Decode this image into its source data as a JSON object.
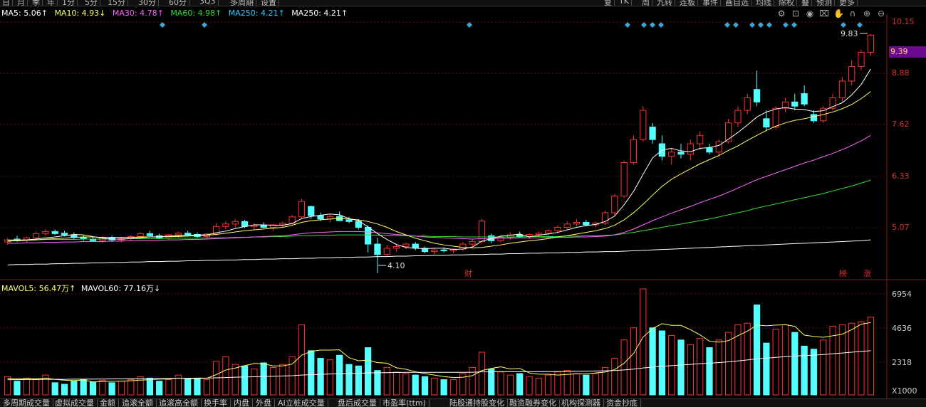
{
  "topbar": {
    "items": [
      "日",
      "月",
      "季",
      "年",
      "1分",
      "5分",
      "15分",
      "30分",
      "60分",
      "3Q3",
      "多周期",
      "设置"
    ],
    "right_items": [
      "复",
      "TK",
      "周",
      "九转",
      "连板",
      "事件",
      "画自选",
      "均线",
      "除权",
      "叠",
      "预测",
      "更多"
    ]
  },
  "ma_legend": {
    "ma5": "MA5: 5.06↑",
    "ma10": "MA10: 4.93↓",
    "ma30": "MA30: 4.78↑",
    "ma60": "MA60: 4.98↑",
    "ma250a": "MA250: 4.21↑",
    "ma250b": "MA250: 4.21↑"
  },
  "price_axis": [
    "10.15",
    "8.88",
    "7.62",
    "6.33",
    "5.07"
  ],
  "current_price": "9.39",
  "high_label": "9.83",
  "low_label": "4.10",
  "markers": {
    "cai": "财",
    "bang": "榜",
    "zhang": "涨"
  },
  "vol_legend": {
    "mavol5": "MAVOL5: 56.47万↑",
    "mavol60": "MAVOL60: 77.16万↓"
  },
  "vol_axis": [
    "6954",
    "4636",
    "2318"
  ],
  "vol_unit": "X1000",
  "bottom_tabs": [
    "多周期成交量",
    "虚拟成交量",
    "金额",
    "追滚全额",
    "追滚高全额",
    "换手率",
    "内盘",
    "外盘",
    "AI立桩成交量",
    "盘后成交量",
    "市盈率(ttm)",
    "陆股通持股变化",
    "融资融券变化",
    "机构探测器",
    "资金抄底"
  ],
  "colors": {
    "up": "#ff3232",
    "down": "#54ffff",
    "ma5": "#ffffff",
    "ma10": "#ffff66",
    "ma30": "#ff66ff",
    "ma60": "#33dd33",
    "ma250": "#ffffff"
  },
  "chart_data": {
    "type": "candlestick",
    "price_ylim": [
      4.0,
      10.3
    ],
    "vol_ylim": [
      0,
      7000
    ],
    "candles": [
      [
        4.85,
        4.95,
        4.78,
        4.9
      ],
      [
        4.92,
        5.0,
        4.85,
        4.88
      ],
      [
        4.9,
        4.98,
        4.82,
        4.95
      ],
      [
        4.95,
        5.1,
        4.9,
        5.05
      ],
      [
        5.05,
        5.15,
        5.0,
        5.1
      ],
      [
        5.1,
        5.15,
        5.02,
        5.05
      ],
      [
        5.06,
        5.12,
        4.98,
        5.02
      ],
      [
        5.02,
        5.08,
        4.92,
        4.96
      ],
      [
        4.96,
        5.02,
        4.88,
        4.92
      ],
      [
        4.92,
        4.98,
        4.85,
        4.88
      ],
      [
        4.88,
        4.98,
        4.82,
        4.95
      ],
      [
        4.95,
        5.0,
        4.85,
        4.9
      ],
      [
        4.9,
        4.98,
        4.84,
        4.93
      ],
      [
        4.93,
        5.02,
        4.88,
        4.98
      ],
      [
        4.98,
        5.08,
        4.92,
        5.05
      ],
      [
        5.05,
        5.12,
        4.98,
        5.0
      ],
      [
        5.0,
        5.05,
        4.92,
        4.95
      ],
      [
        4.95,
        5.04,
        4.9,
        5.02
      ],
      [
        5.02,
        5.1,
        4.96,
        5.06
      ],
      [
        5.06,
        5.12,
        5.0,
        5.03
      ],
      [
        5.03,
        5.08,
        4.95,
        4.98
      ],
      [
        4.98,
        5.06,
        4.92,
        5.04
      ],
      [
        5.04,
        5.3,
        5.0,
        5.22
      ],
      [
        5.22,
        5.35,
        5.15,
        5.28
      ],
      [
        5.28,
        5.4,
        5.2,
        5.34
      ],
      [
        5.34,
        5.38,
        5.18,
        5.22
      ],
      [
        5.22,
        5.3,
        5.15,
        5.25
      ],
      [
        5.25,
        5.32,
        5.18,
        5.2
      ],
      [
        5.2,
        5.28,
        5.12,
        5.26
      ],
      [
        5.26,
        5.34,
        5.2,
        5.3
      ],
      [
        5.3,
        5.5,
        5.25,
        5.45
      ],
      [
        5.45,
        5.88,
        5.4,
        5.82
      ],
      [
        5.7,
        5.72,
        5.4,
        5.48
      ],
      [
        5.48,
        5.55,
        5.35,
        5.4
      ],
      [
        5.4,
        5.52,
        5.32,
        5.46
      ],
      [
        5.46,
        5.58,
        5.4,
        5.36
      ],
      [
        5.38,
        5.45,
        5.3,
        5.34
      ],
      [
        5.34,
        5.4,
        5.15,
        5.2
      ],
      [
        5.2,
        5.25,
        4.6,
        4.8
      ],
      [
        4.8,
        4.95,
        4.1,
        4.55
      ],
      [
        4.55,
        4.78,
        4.5,
        4.7
      ],
      [
        4.7,
        4.8,
        4.62,
        4.74
      ],
      [
        4.74,
        4.84,
        4.68,
        4.8
      ],
      [
        4.8,
        4.85,
        4.65,
        4.7
      ],
      [
        4.7,
        4.74,
        4.58,
        4.62
      ],
      [
        4.62,
        4.7,
        4.55,
        4.66
      ],
      [
        4.66,
        4.72,
        4.6,
        4.64
      ],
      [
        4.64,
        4.7,
        4.58,
        4.68
      ],
      [
        4.68,
        4.85,
        4.64,
        4.8
      ],
      [
        4.8,
        4.92,
        4.75,
        4.86
      ],
      [
        4.86,
        5.4,
        4.82,
        5.35
      ],
      [
        5.0,
        5.05,
        4.82,
        4.88
      ],
      [
        4.88,
        5.0,
        4.84,
        4.96
      ],
      [
        4.96,
        5.08,
        4.9,
        5.02
      ],
      [
        5.02,
        5.1,
        4.95,
        4.98
      ],
      [
        4.98,
        5.05,
        4.92,
        5.03
      ],
      [
        5.03,
        5.1,
        4.98,
        5.06
      ],
      [
        5.06,
        5.15,
        5.0,
        5.12
      ],
      [
        5.12,
        5.25,
        5.06,
        5.2
      ],
      [
        5.2,
        5.35,
        5.14,
        5.28
      ],
      [
        5.28,
        5.4,
        5.22,
        5.32
      ],
      [
        5.32,
        5.38,
        5.24,
        5.26
      ],
      [
        5.26,
        5.34,
        5.2,
        5.3
      ],
      [
        5.3,
        5.6,
        5.26,
        5.55
      ],
      [
        5.55,
        6.0,
        5.5,
        5.95
      ],
      [
        5.95,
        6.8,
        5.9,
        6.75
      ],
      [
        6.75,
        7.4,
        6.7,
        7.3
      ],
      [
        7.3,
        8.1,
        7.25,
        8.0
      ],
      [
        7.6,
        7.7,
        7.2,
        7.3
      ],
      [
        7.2,
        7.4,
        6.8,
        6.9
      ],
      [
        6.9,
        7.1,
        6.7,
        7.0
      ],
      [
        7.0,
        7.2,
        6.85,
        6.95
      ],
      [
        6.95,
        7.3,
        6.8,
        7.2
      ],
      [
        7.2,
        7.5,
        7.05,
        7.4
      ],
      [
        7.1,
        7.2,
        6.95,
        7.0
      ],
      [
        7.0,
        7.3,
        6.9,
        7.25
      ],
      [
        7.25,
        7.8,
        7.2,
        7.7
      ],
      [
        7.7,
        8.1,
        7.6,
        8.0
      ],
      [
        8.0,
        8.4,
        7.9,
        8.3
      ],
      [
        8.5,
        8.95,
        8.1,
        8.2
      ],
      [
        7.8,
        8.0,
        7.5,
        7.6
      ],
      [
        7.6,
        8.1,
        7.55,
        8.05
      ],
      [
        8.05,
        8.3,
        7.95,
        8.2
      ],
      [
        8.2,
        8.4,
        8.0,
        8.1
      ],
      [
        8.4,
        8.6,
        8.1,
        8.15
      ],
      [
        7.9,
        8.0,
        7.7,
        7.75
      ],
      [
        7.75,
        8.1,
        7.7,
        8.05
      ],
      [
        8.05,
        8.4,
        8.0,
        8.3
      ],
      [
        8.3,
        8.8,
        8.2,
        8.7
      ],
      [
        8.7,
        9.2,
        8.6,
        9.05
      ],
      [
        9.05,
        9.45,
        8.95,
        9.39
      ],
      [
        9.39,
        9.83,
        9.3,
        9.8
      ]
    ],
    "volumes": [
      1200,
      900,
      1100,
      1000,
      1300,
      800,
      700,
      900,
      1000,
      850,
      950,
      800,
      900,
      1000,
      1200,
      1100,
      900,
      1000,
      1300,
      1050,
      1100,
      1000,
      2200,
      2500,
      2000,
      1900,
      1700,
      2100,
      1800,
      2000,
      2500,
      4600,
      2900,
      2400,
      2300,
      2600,
      2000,
      1900,
      3100,
      1600,
      1800,
      1500,
      1400,
      1300,
      1200,
      1100,
      1000,
      1000,
      1400,
      1800,
      2800,
      1700,
      1500,
      1300,
      1400,
      1200,
      1100,
      1300,
      1500,
      1600,
      1400,
      1300,
      1400,
      1800,
      2400,
      3600,
      4400,
      6954,
      4400,
      4200,
      3900,
      3600,
      3300,
      3700,
      3100,
      3600,
      4100,
      4600,
      4700,
      5900,
      3400,
      4300,
      4600,
      4100,
      3200,
      3000,
      3600,
      4500,
      4600,
      4700,
      4800,
      5100
    ],
    "ma5": [
      4.88,
      4.89,
      4.9,
      4.92,
      4.95,
      4.97,
      5.0,
      5.03,
      5.02,
      4.98,
      4.94,
      4.92,
      4.92,
      4.93,
      4.95,
      4.97,
      4.98,
      4.99,
      5.0,
      5.01,
      5.02,
      5.02,
      5.07,
      5.11,
      5.17,
      5.22,
      5.26,
      5.26,
      5.25,
      5.25,
      5.29,
      5.41,
      5.46,
      5.49,
      5.52,
      5.5,
      5.41,
      5.36,
      5.21,
      5.05,
      4.91,
      4.79,
      4.72,
      4.7,
      4.69,
      4.7,
      4.7,
      4.67,
      4.68,
      4.73,
      4.87,
      4.93,
      4.99,
      5.01,
      5.04,
      4.97,
      5.01,
      5.04,
      5.08,
      5.14,
      5.2,
      5.24,
      5.27,
      5.34,
      5.47,
      5.74,
      6.06,
      6.47,
      6.86,
      7.05,
      7.09,
      7.03,
      7.01,
      7.09,
      7.11,
      7.16,
      7.31,
      7.47,
      7.65,
      7.84,
      7.96,
      8.03,
      8.07,
      8.03,
      8.02,
      7.97,
      7.99,
      8.09,
      8.18,
      8.37,
      8.62,
      8.99
    ],
    "ma10": [
      4.87,
      4.88,
      4.89,
      4.9,
      4.92,
      4.93,
      4.94,
      4.96,
      4.97,
      4.97,
      4.96,
      4.96,
      4.96,
      4.96,
      4.97,
      4.97,
      4.97,
      4.98,
      4.98,
      4.99,
      5.0,
      5.01,
      5.03,
      5.06,
      5.09,
      5.12,
      5.14,
      5.16,
      5.18,
      5.2,
      5.25,
      5.32,
      5.36,
      5.38,
      5.4,
      5.41,
      5.4,
      5.38,
      5.34,
      5.28,
      5.2,
      5.1,
      5.02,
      4.94,
      4.88,
      4.82,
      4.78,
      4.75,
      4.72,
      4.71,
      4.72,
      4.75,
      4.78,
      4.82,
      4.85,
      4.88,
      4.9,
      4.93,
      4.97,
      5.0,
      5.04,
      5.08,
      5.12,
      5.17,
      5.25,
      5.38,
      5.55,
      5.75,
      5.97,
      6.18,
      6.35,
      6.48,
      6.6,
      6.72,
      6.82,
      6.92,
      7.04,
      7.15,
      7.28,
      7.4,
      7.52,
      7.62,
      7.7,
      7.76,
      7.8,
      7.85,
      7.9,
      7.96,
      8.04,
      8.14,
      8.28,
      8.45
    ],
    "ma30": [
      4.82,
      4.82,
      4.83,
      4.83,
      4.84,
      4.84,
      4.85,
      4.85,
      4.86,
      4.86,
      4.86,
      4.87,
      4.87,
      4.88,
      4.88,
      4.89,
      4.89,
      4.9,
      4.9,
      4.91,
      4.91,
      4.92,
      4.93,
      4.94,
      4.95,
      4.96,
      4.97,
      4.98,
      4.99,
      5.0,
      5.02,
      5.05,
      5.07,
      5.08,
      5.09,
      5.1,
      5.1,
      5.1,
      5.09,
      5.07,
      5.05,
      5.03,
      5.01,
      4.99,
      4.97,
      4.96,
      4.95,
      4.94,
      4.93,
      4.92,
      4.93,
      4.93,
      4.94,
      4.94,
      4.95,
      4.95,
      4.95,
      4.96,
      4.96,
      4.96,
      4.97,
      4.97,
      4.98,
      4.99,
      5.02,
      5.08,
      5.16,
      5.26,
      5.36,
      5.45,
      5.54,
      5.62,
      5.7,
      5.79,
      5.87,
      5.95,
      6.04,
      6.14,
      6.24,
      6.34,
      6.42,
      6.5,
      6.58,
      6.66,
      6.74,
      6.81,
      6.89,
      6.97,
      7.06,
      7.16,
      7.27,
      7.4
    ],
    "ma60": [
      4.9,
      4.9,
      4.9,
      4.9,
      4.91,
      4.91,
      4.91,
      4.91,
      4.92,
      4.92,
      4.92,
      4.92,
      4.92,
      4.93,
      4.93,
      4.93,
      4.93,
      4.94,
      4.94,
      4.94,
      4.94,
      4.95,
      4.95,
      4.95,
      4.96,
      4.96,
      4.97,
      4.97,
      4.98,
      4.98,
      4.99,
      5.0,
      5.0,
      5.01,
      5.01,
      5.02,
      5.02,
      5.02,
      5.02,
      5.01,
      5.01,
      5.0,
      5.0,
      4.99,
      4.99,
      4.98,
      4.98,
      4.98,
      4.97,
      4.97,
      4.97,
      4.97,
      4.97,
      4.97,
      4.97,
      4.98,
      4.98,
      4.98,
      4.98,
      4.99,
      4.99,
      5.0,
      5.0,
      5.01,
      5.02,
      5.05,
      5.08,
      5.12,
      5.16,
      5.2,
      5.24,
      5.28,
      5.32,
      5.36,
      5.4,
      5.45,
      5.5,
      5.55,
      5.6,
      5.66,
      5.71,
      5.76,
      5.81,
      5.86,
      5.91,
      5.96,
      6.01,
      6.07,
      6.13,
      6.19,
      6.26,
      6.33
    ],
    "ma250": [
      4.3,
      4.31,
      4.31,
      4.32,
      4.32,
      4.33,
      4.33,
      4.34,
      4.34,
      4.35,
      4.35,
      4.36,
      4.36,
      4.37,
      4.37,
      4.38,
      4.38,
      4.39,
      4.39,
      4.4,
      4.4,
      4.41,
      4.41,
      4.42,
      4.42,
      4.43,
      4.43,
      4.44,
      4.44,
      4.45,
      4.45,
      4.46,
      4.46,
      4.47,
      4.47,
      4.48,
      4.48,
      4.49,
      4.49,
      4.5,
      4.5,
      4.51,
      4.51,
      4.52,
      4.52,
      4.53,
      4.53,
      4.54,
      4.54,
      4.55,
      4.55,
      4.56,
      4.56,
      4.57,
      4.57,
      4.58,
      4.58,
      4.59,
      4.59,
      4.6,
      4.6,
      4.61,
      4.61,
      4.62,
      4.62,
      4.63,
      4.64,
      4.65,
      4.66,
      4.67,
      4.68,
      4.69,
      4.7,
      4.71,
      4.72,
      4.73,
      4.74,
      4.75,
      4.76,
      4.77,
      4.78,
      4.79,
      4.8,
      4.81,
      4.82,
      4.83,
      4.84,
      4.85,
      4.86,
      4.87,
      4.88,
      4.9
    ],
    "mavol5": [
      1100,
      1050,
      1080,
      1060,
      1100,
      1020,
      960,
      940,
      980,
      850,
      880,
      890,
      900,
      930,
      970,
      1000,
      1040,
      1040,
      1100,
      1070,
      1070,
      1090,
      1330,
      1630,
      1760,
      1920,
      2060,
      2040,
      1900,
      1900,
      2020,
      2600,
      2860,
      2940,
      2940,
      2960,
      2440,
      2240,
      2280,
      2120,
      2080,
      1780,
      1680,
      1520,
      1400,
      1300,
      1200,
      1140,
      1160,
      1260,
      1600,
      1740,
      1840,
      1700,
      1740,
      1440,
      1360,
      1360,
      1300,
      1340,
      1380,
      1380,
      1440,
      1500,
      1660,
      2080,
      2720,
      3790,
      4350,
      4670,
      4560,
      4560,
      4280,
      3940,
      3520,
      3460,
      3560,
      3880,
      4180,
      4580,
      4530,
      4580,
      4600,
      4500,
      3920,
      3840,
      3780,
      3880,
      3980,
      4280,
      4640,
      4740
    ],
    "mavol60": [
      1000,
      1000,
      1010,
      1010,
      1020,
      1020,
      1020,
      1030,
      1030,
      1040,
      1040,
      1050,
      1050,
      1060,
      1060,
      1070,
      1070,
      1080,
      1090,
      1090,
      1100,
      1100,
      1120,
      1140,
      1160,
      1180,
      1190,
      1210,
      1220,
      1240,
      1260,
      1300,
      1330,
      1350,
      1370,
      1390,
      1400,
      1420,
      1440,
      1450,
      1460,
      1470,
      1480,
      1480,
      1480,
      1480,
      1480,
      1480,
      1480,
      1490,
      1510,
      1510,
      1520,
      1520,
      1520,
      1520,
      1520,
      1530,
      1530,
      1540,
      1550,
      1560,
      1570,
      1580,
      1600,
      1640,
      1690,
      1770,
      1820,
      1870,
      1920,
      1960,
      2000,
      2050,
      2080,
      2120,
      2170,
      2230,
      2290,
      2370,
      2410,
      2460,
      2510,
      2550,
      2580,
      2610,
      2650,
      2700,
      2750,
      2800,
      2850,
      2900
    ]
  }
}
